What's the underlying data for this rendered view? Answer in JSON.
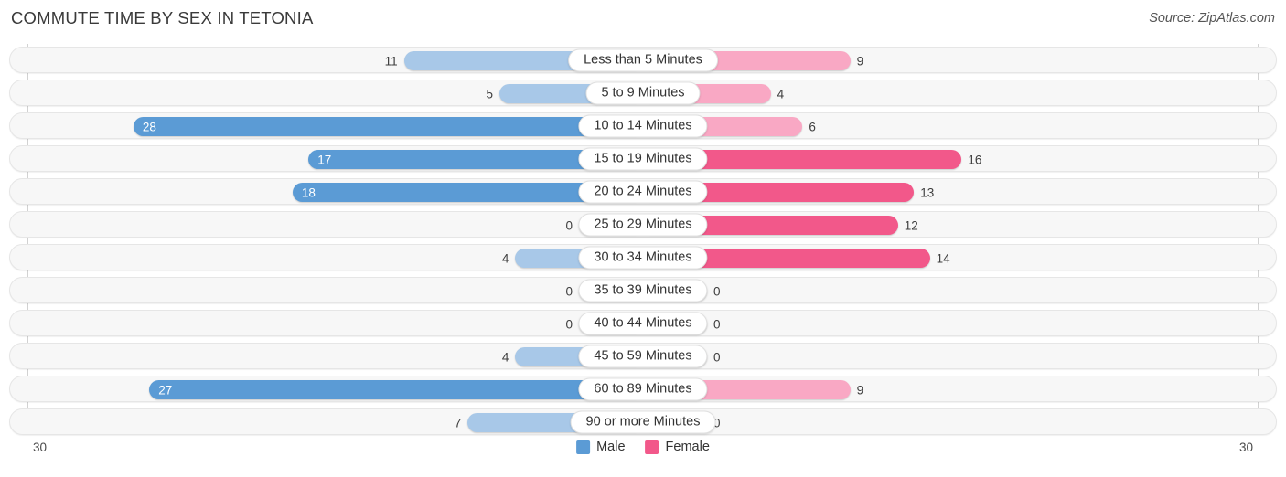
{
  "header": {
    "title": "COMMUTE TIME BY SEX IN TETONIA",
    "source": "Source: ZipAtlas.com"
  },
  "axis": {
    "left_label": "30",
    "right_label": "30",
    "max": 30
  },
  "legend": {
    "items": [
      {
        "label": "Male",
        "color": "#5b9bd5"
      },
      {
        "label": "Female",
        "color": "#f2588a"
      }
    ]
  },
  "colors": {
    "male_strong": "#5b9bd5",
    "male_light": "#a8c8e8",
    "female_strong": "#f2588a",
    "female_light": "#f9a8c4",
    "track": "#f7f7f7"
  },
  "chart_data": {
    "type": "bar",
    "orientation": "horizontal-diverging",
    "title": "COMMUTE TIME BY SEX IN TETONIA",
    "xlabel": "",
    "ylabel": "",
    "xlim": [
      30,
      30
    ],
    "grid": false,
    "legend_position": "bottom-center",
    "categories": [
      "Less than 5 Minutes",
      "5 to 9 Minutes",
      "10 to 14 Minutes",
      "15 to 19 Minutes",
      "20 to 24 Minutes",
      "25 to 29 Minutes",
      "30 to 34 Minutes",
      "35 to 39 Minutes",
      "40 to 44 Minutes",
      "45 to 59 Minutes",
      "60 to 89 Minutes",
      "90 or more Minutes"
    ],
    "series": [
      {
        "name": "Male",
        "values": [
          11,
          5,
          28,
          17,
          18,
          0,
          4,
          0,
          0,
          4,
          27,
          7
        ]
      },
      {
        "name": "Female",
        "values": [
          9,
          4,
          6,
          16,
          13,
          12,
          14,
          0,
          0,
          0,
          9,
          0
        ]
      }
    ]
  },
  "rows": [
    {
      "label": "Less than 5 Minutes",
      "male": "11",
      "female": "9"
    },
    {
      "label": "5 to 9 Minutes",
      "male": "5",
      "female": "4"
    },
    {
      "label": "10 to 14 Minutes",
      "male": "28",
      "female": "6"
    },
    {
      "label": "15 to 19 Minutes",
      "male": "17",
      "female": "16"
    },
    {
      "label": "20 to 24 Minutes",
      "male": "18",
      "female": "13"
    },
    {
      "label": "25 to 29 Minutes",
      "male": "0",
      "female": "12"
    },
    {
      "label": "30 to 34 Minutes",
      "male": "4",
      "female": "14"
    },
    {
      "label": "35 to 39 Minutes",
      "male": "0",
      "female": "0"
    },
    {
      "label": "40 to 44 Minutes",
      "male": "0",
      "female": "0"
    },
    {
      "label": "45 to 59 Minutes",
      "male": "4",
      "female": "0"
    },
    {
      "label": "60 to 89 Minutes",
      "male": "27",
      "female": "9"
    },
    {
      "label": "90 or more Minutes",
      "male": "7",
      "female": "0"
    }
  ]
}
